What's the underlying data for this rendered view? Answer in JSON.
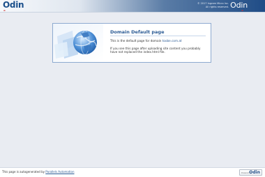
{
  "header": {
    "logo_left": "Odin",
    "copyright": "© 2017 Ingram Micro Inc.",
    "rights": "All rights reserved.",
    "logo_right": "Odin"
  },
  "panel": {
    "title": "Domain Default page",
    "line1_prefix": "This is the default page for domain",
    "domain": "toobe.com.at",
    "line2": "If you see this page after uploading site content you probably have not replaced the index.html file."
  },
  "footer": {
    "text": "This page is autogenerated by",
    "link": "Parallels Automation",
    "badge_small": "Powered by",
    "badge_logo": "Odin"
  },
  "colors": {
    "accent": "#2a5a94",
    "header_dark": "#1f4c86",
    "background": "#e9ecf2"
  }
}
